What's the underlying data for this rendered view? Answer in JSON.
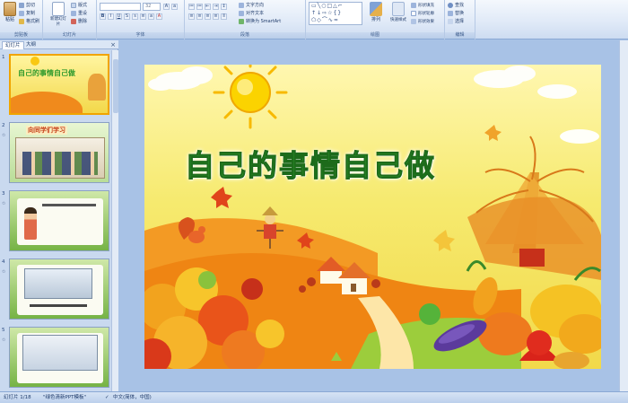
{
  "ribbon": {
    "clipboard": {
      "label": "剪贴板",
      "paste": "粘贴",
      "cut": "剪切",
      "copy": "复制",
      "format_painter": "格式刷"
    },
    "slides": {
      "label": "幻灯片",
      "new_slide": "新建幻灯片",
      "layout": "版式",
      "reset": "重设",
      "delete": "删除"
    },
    "font": {
      "label": "字体",
      "font_size": "32"
    },
    "paragraph": {
      "label": "段落",
      "text_direction": "文字方向",
      "align_text": "对齐文本",
      "smartart": "转换为 SmartArt"
    },
    "drawing": {
      "label": "绘图",
      "arrange": "排列",
      "quick_styles": "快速样式",
      "shape_fill": "形状填充",
      "shape_outline": "形状轮廓",
      "shape_effects": "形状效果"
    },
    "editing": {
      "label": "编辑",
      "find": "查找",
      "replace": "替换",
      "select": "选择"
    }
  },
  "left_panel": {
    "tabs": [
      "幻灯片",
      "大纲"
    ],
    "close": "×",
    "slides": [
      {
        "number": "1",
        "title": "自己的事情自己做"
      },
      {
        "number": "2",
        "title": "向同学们学习"
      },
      {
        "number": "3",
        "title": ""
      },
      {
        "number": "4",
        "title": ""
      },
      {
        "number": "5",
        "title": ""
      }
    ]
  },
  "slide": {
    "title": "自己的事情自己做",
    "colors": {
      "title": "#2f9a2d",
      "sky": "#f6ea6f",
      "hill": "#f08a1c",
      "selection": "#f0a400"
    }
  },
  "status": {
    "slide_info": "幻灯片 1/18",
    "theme": "\"绿色清新PPT模板\"",
    "language": "中文(简体，中国)"
  }
}
